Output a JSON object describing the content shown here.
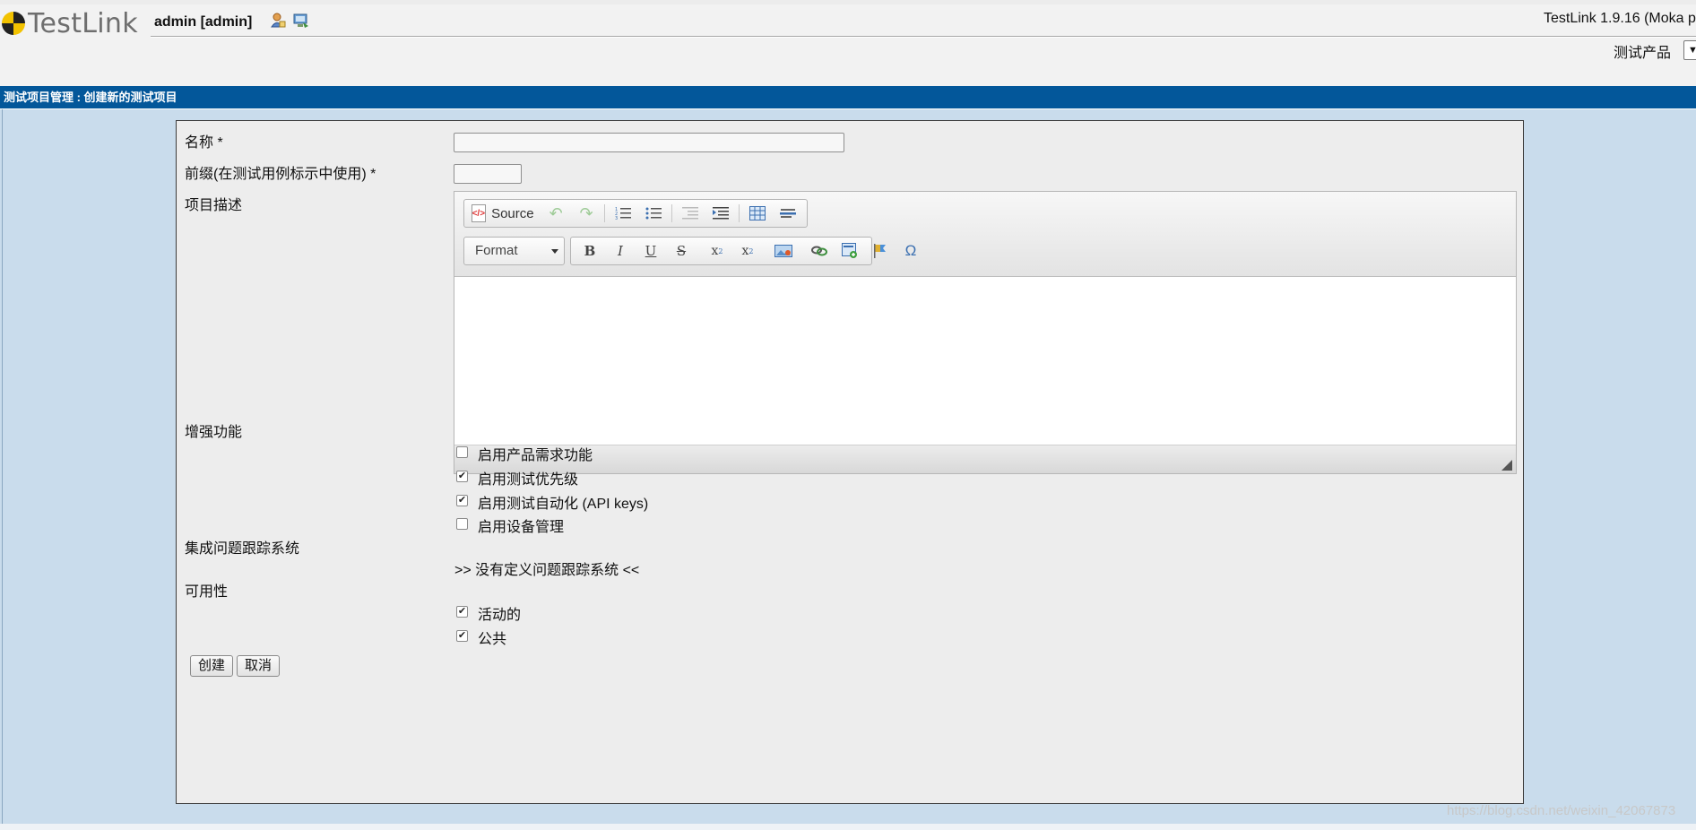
{
  "header": {
    "logo_text": "TestLink",
    "user": "admin [admin]",
    "version": "TestLink 1.9.16 (Moka p",
    "product_label": "测试产品",
    "product_select_value": "▼"
  },
  "title_bar": "测试项目管理 : 创建新的测试项目",
  "form": {
    "name_label": "名称 *",
    "prefix_label": "前缀(在测试用例标示中使用) *",
    "description_label": "项目描述",
    "enhanced_label": "增强功能",
    "features": [
      {
        "label": "启用产品需求功能",
        "checked": false
      },
      {
        "label": "启用测试优先级",
        "checked": true
      },
      {
        "label": "启用测试自动化 (API keys)",
        "checked": true
      },
      {
        "label": "启用设备管理",
        "checked": false
      }
    ],
    "issue_tracker_label": "集成问题跟踪系统",
    "issue_tracker_value": ">> 没有定义问题跟踪系统 <<",
    "availability_label": "可用性",
    "availability": [
      {
        "label": "活动的",
        "checked": true
      },
      {
        "label": "公共",
        "checked": true
      }
    ],
    "create_button": "创建",
    "cancel_button": "取消"
  },
  "editor": {
    "source_label": "Source",
    "format_label": "Format",
    "icons": [
      "source-icon",
      "undo-icon",
      "redo-icon",
      "numbered-list-icon",
      "bulleted-list-icon",
      "outdent-icon",
      "indent-icon",
      "table-icon",
      "horizontal-rule-icon",
      "bold-icon",
      "italic-icon",
      "underline-icon",
      "strike-icon",
      "subscript-icon",
      "superscript-icon",
      "image-icon",
      "link-icon",
      "insert-template-icon",
      "anchor-flag-icon",
      "omega-special-char-icon"
    ]
  },
  "watermark": "https://blog.csdn.net/weixin_42067873"
}
